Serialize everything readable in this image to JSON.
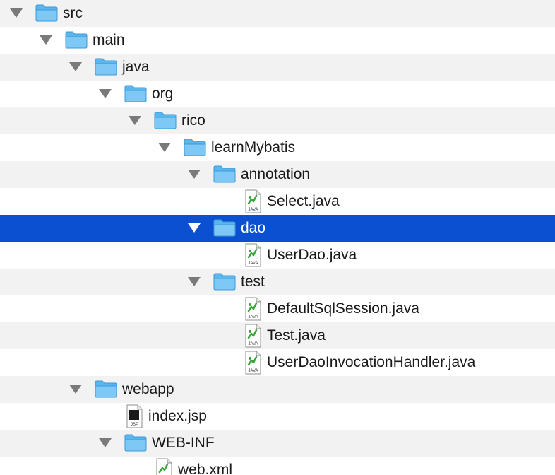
{
  "tree": {
    "items": [
      {
        "label": "src",
        "kind": "folder",
        "depth": 0,
        "expanded": true
      },
      {
        "label": "main",
        "kind": "folder",
        "depth": 1,
        "expanded": true
      },
      {
        "label": "java",
        "kind": "folder",
        "depth": 2,
        "expanded": true
      },
      {
        "label": "org",
        "kind": "folder",
        "depth": 3,
        "expanded": true
      },
      {
        "label": "rico",
        "kind": "folder",
        "depth": 4,
        "expanded": true
      },
      {
        "label": "learnMybatis",
        "kind": "folder",
        "depth": 5,
        "expanded": true
      },
      {
        "label": "annotation",
        "kind": "folder",
        "depth": 6,
        "expanded": true
      },
      {
        "label": "Select.java",
        "kind": "java-file",
        "depth": 7
      },
      {
        "label": "dao",
        "kind": "folder",
        "depth": 6,
        "expanded": true,
        "selected": true
      },
      {
        "label": "UserDao.java",
        "kind": "java-file",
        "depth": 7
      },
      {
        "label": "test",
        "kind": "folder",
        "depth": 6,
        "expanded": true
      },
      {
        "label": "DefaultSqlSession.java",
        "kind": "java-file",
        "depth": 7
      },
      {
        "label": "Test.java",
        "kind": "java-file",
        "depth": 7
      },
      {
        "label": "UserDaoInvocationHandler.java",
        "kind": "java-file",
        "depth": 7
      },
      {
        "label": "webapp",
        "kind": "folder",
        "depth": 2,
        "expanded": true
      },
      {
        "label": "index.jsp",
        "kind": "jsp-file",
        "depth": 3
      },
      {
        "label": "WEB-INF",
        "kind": "folder",
        "depth": 3,
        "expanded": true
      },
      {
        "label": "web.xml",
        "kind": "xml-file",
        "depth": 4
      }
    ],
    "file_badges": {
      "java-file": "JAVA",
      "jsp-file": "JSP"
    }
  },
  "colors": {
    "selection": "#0a50d0",
    "stripe": "#f2f2f2",
    "folder": "#5ab6ee",
    "disclosure": "#7a7a7a"
  }
}
